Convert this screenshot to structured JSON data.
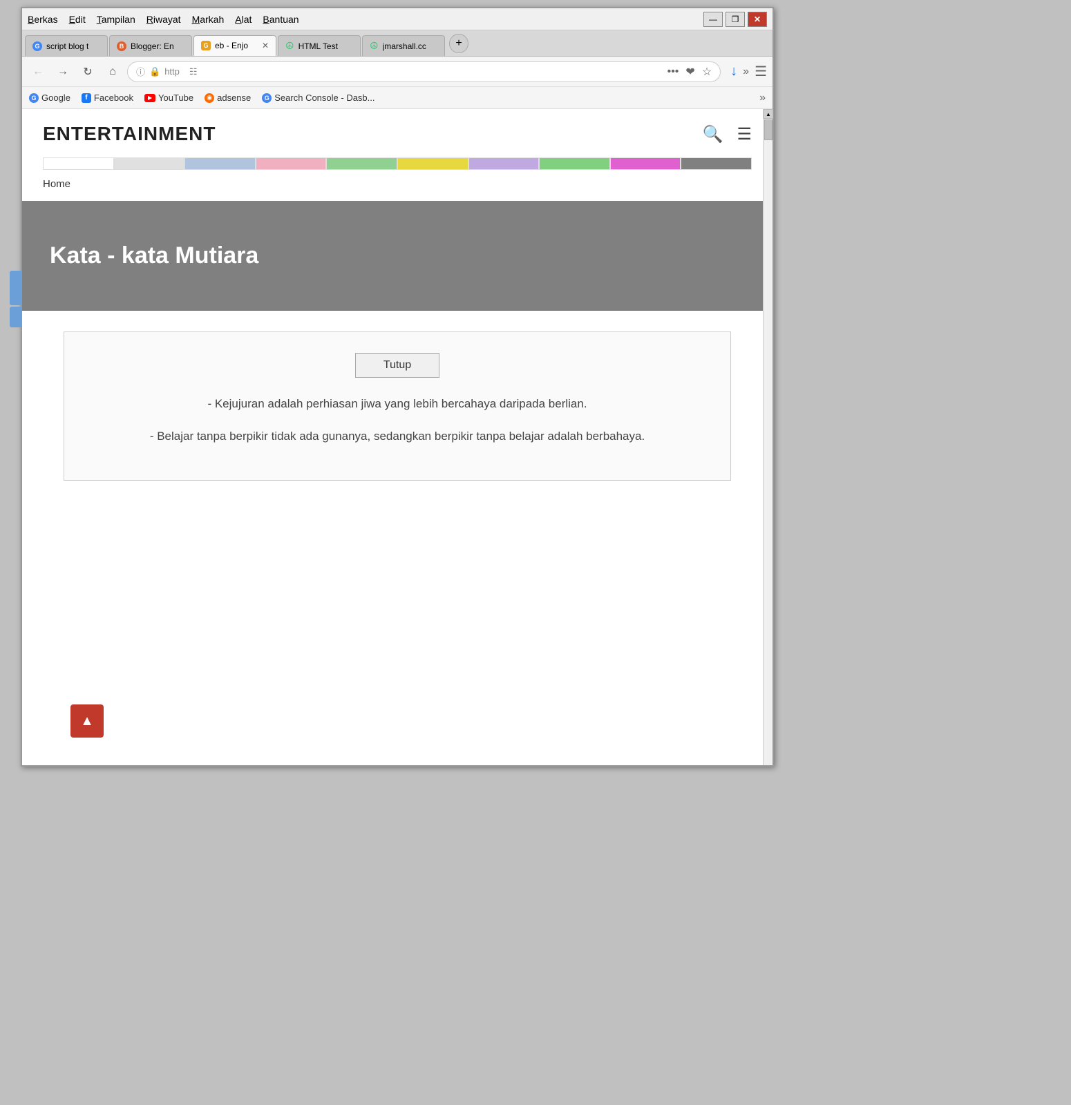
{
  "browser": {
    "menu": {
      "items": [
        "Berkas",
        "Edit",
        "Tampilan",
        "Riwayat",
        "Markah",
        "Alat",
        "Bantuan"
      ]
    },
    "window_controls": {
      "minimize": "—",
      "maximize": "❐",
      "close": "✕"
    },
    "tabs": [
      {
        "id": "tab1",
        "favicon_color": "#4285F4",
        "favicon_letter": "G",
        "label": "script blog t",
        "active": false
      },
      {
        "id": "tab2",
        "favicon_color": "#e05d2e",
        "favicon_letter": "B",
        "label": "Blogger: En",
        "active": false
      },
      {
        "id": "tab3",
        "favicon_color": "#e8a020",
        "favicon_letter": "G",
        "label": "eb - Enjo",
        "active": true,
        "closable": true
      },
      {
        "id": "tab4",
        "favicon_color": "#2ecc71",
        "favicon_letter": "☮",
        "label": "HTML Test",
        "active": false
      },
      {
        "id": "tab5",
        "favicon_color": "#2ecc71",
        "favicon_letter": "☮",
        "label": "jmarshall.cc",
        "active": false
      }
    ],
    "address_bar": {
      "url": "http",
      "placeholder": "http"
    },
    "bookmarks": [
      {
        "id": "bm1",
        "icon": "G",
        "icon_color": "#4285F4",
        "label": "Google"
      },
      {
        "id": "bm2",
        "icon": "f",
        "icon_color": "#1877f2",
        "label": "Facebook"
      },
      {
        "id": "bm3",
        "icon": "▶",
        "icon_color": "#ff0000",
        "label": "YouTube"
      },
      {
        "id": "bm4",
        "icon": "◉",
        "icon_color": "#ff6a00",
        "label": "adsense"
      },
      {
        "id": "bm5",
        "icon": "G",
        "icon_color": "#4285F4",
        "label": "Search Console - Dasb..."
      }
    ]
  },
  "website": {
    "logo": "ENTERTAINMENT",
    "nav": {
      "home_label": "Home"
    },
    "color_segments": [
      "#ffffff",
      "#e0e0e0",
      "#b0c4de",
      "#f0b0c0",
      "#90d090",
      "#e8d840",
      "#c0a8e0",
      "#80d080",
      "#e060d0",
      "#808080"
    ],
    "hero": {
      "title": "Kata - kata Mutiara",
      "bg_color": "#808080"
    },
    "card": {
      "tutup_label": "Tutup",
      "quotes": [
        "- Kejujuran adalah perhiasan jiwa yang lebih bercahaya daripada berlian.",
        "- Belajar tanpa berpikir tidak ada gunanya, sedangkan berpikir tanpa belajar adalah berbahaya."
      ]
    },
    "scroll_top_label": "▲"
  }
}
